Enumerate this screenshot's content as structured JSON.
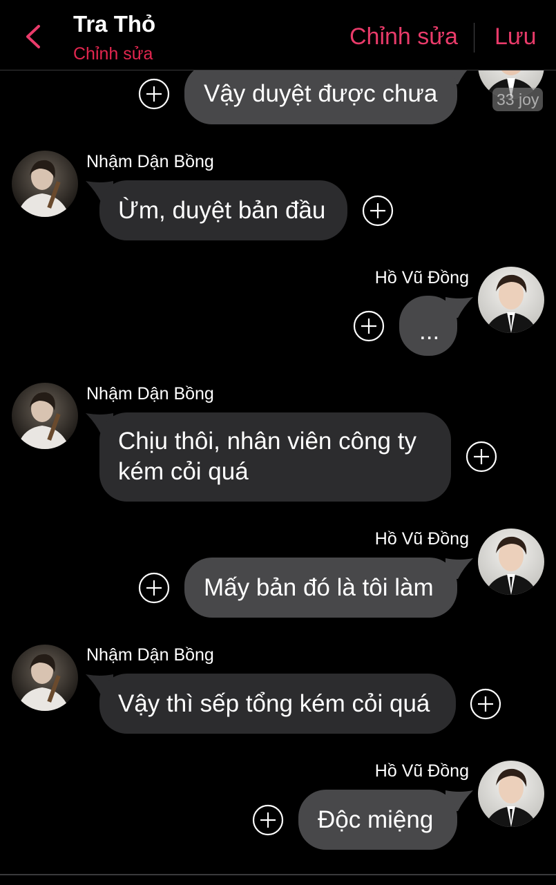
{
  "header": {
    "title": "Tra Thỏ",
    "subtitle": "Chỉnh sửa",
    "edit_label": "Chỉnh sửa",
    "save_label": "Lưu",
    "accent_color": "#e93b6a",
    "back_icon": "chevron-left-icon"
  },
  "watermark": "33 joy",
  "messages": [
    {
      "side": "right",
      "text": "Vậy duyệt được chưa"
    },
    {
      "side": "left",
      "sender": "Nhậm Dận Bồng",
      "text": "Ừm, duyệt bản đầu"
    },
    {
      "side": "right",
      "sender": "Hồ Vũ Đồng",
      "text": "..."
    },
    {
      "side": "left",
      "sender": "Nhậm Dận Bồng",
      "lines": [
        "Chịu thôi, nhân viên công ty",
        "kém cỏi quá"
      ]
    },
    {
      "side": "right",
      "sender": "Hồ Vũ Đồng",
      "text": "Mấy bản đó là tôi làm"
    },
    {
      "side": "left",
      "sender": "Nhậm Dận Bồng",
      "text": "Vậy thì sếp tổng kém cỏi quá"
    },
    {
      "side": "right",
      "sender": "Hồ Vũ Đồng",
      "text": "Độc miệng"
    }
  ],
  "colors": {
    "background": "#000000",
    "incoming_bubble": "#2c2c2e",
    "outgoing_bubble": "#48484a"
  }
}
